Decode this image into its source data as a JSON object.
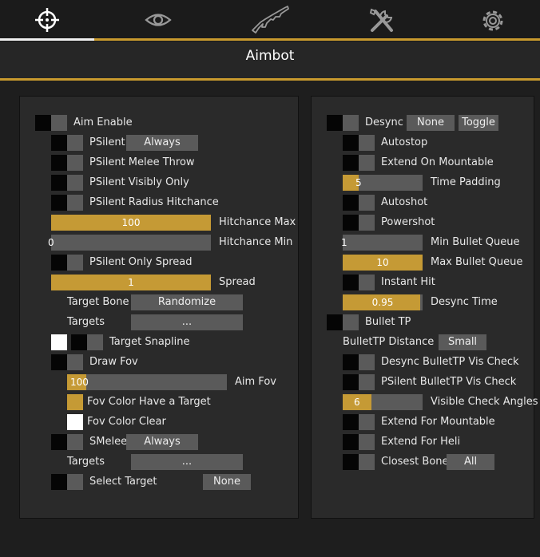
{
  "tabs": [
    {
      "icon": "crosshair-icon",
      "active": true
    },
    {
      "icon": "eye-icon",
      "active": false
    },
    {
      "icon": "rifle-icon",
      "active": false
    },
    {
      "icon": "tools-icon",
      "active": false
    },
    {
      "icon": "gear-icon",
      "active": false
    }
  ],
  "colors": {
    "accent": "#c99a2e",
    "fill": "#c59a35",
    "track": "#5a5a5a",
    "panel": "#2a2a2a"
  },
  "title": "Aimbot",
  "left": {
    "aim_enable": "Aim Enable",
    "psilent": "PSilent",
    "psilent_mode": "Always",
    "psilent_melee_throw": "PSilent Melee Throw",
    "psilent_visibly_only": "PSilent Visibly Only",
    "psilent_radius_hitchance": "PSilent Radius Hitchance",
    "hitchance_max": {
      "label": "Hitchance Max",
      "value": "100",
      "fraction": 1.0
    },
    "hitchance_min": {
      "label": "Hitchance Min",
      "value": "0",
      "fraction": 0.0
    },
    "psilent_only_spread": "PSilent Only Spread",
    "spread": {
      "label": "Spread",
      "value": "1",
      "fraction": 1.0
    },
    "target_bone": {
      "label": "Target Bone",
      "value": "Randomize"
    },
    "targets_1": {
      "label": "Targets",
      "value": "..."
    },
    "target_snapline": "Target Snapline",
    "draw_fov": "Draw Fov",
    "aim_fov": {
      "label": "Aim Fov",
      "value": "100",
      "fraction": 0.12
    },
    "fov_color_target": {
      "label": "Fov Color Have a Target",
      "color": "#c59a35"
    },
    "fov_color_clear": {
      "label": "Fov Color Clear",
      "color": "#ffffff"
    },
    "smelee": {
      "label": "SMelee",
      "value": "Always"
    },
    "targets_2": {
      "label": "Targets",
      "value": "..."
    },
    "select_target": {
      "label": "Select Target",
      "value": "None"
    }
  },
  "right": {
    "desync": {
      "label": "Desync",
      "mode": "None",
      "bind": "Toggle"
    },
    "autostop": "Autostop",
    "extend_on_mountable": "Extend On Mountable",
    "time_padding": {
      "label": "Time Padding",
      "value": "5",
      "fraction": 0.2
    },
    "autoshot": "Autoshot",
    "powershot": "Powershot",
    "min_bullet_queue": {
      "label": "Min Bullet Queue",
      "value": "1",
      "fraction": 0.0
    },
    "max_bullet_queue": {
      "label": "Max Bullet Queue",
      "value": "10",
      "fraction": 1.0
    },
    "instant_hit": "Instant Hit",
    "desync_time": {
      "label": "Desync Time",
      "value": "0.95",
      "fraction": 0.97
    },
    "bullet_tp": "Bullet TP",
    "bullettp_distance": {
      "label": "BulletTP Distance",
      "value": "Small"
    },
    "desync_bullettp_vis": "Desync BulletTP Vis Check",
    "psilent_bullettp_vis": "PSilent BulletTP Vis Check",
    "visible_check_angles": {
      "label": "Visible Check Angles",
      "value": "6",
      "fraction": 0.36
    },
    "extend_for_mountable": "Extend For Mountable",
    "extend_for_heli": "Extend For Heli",
    "closest_bone": {
      "label": "Closest Bone",
      "value": "All"
    }
  }
}
